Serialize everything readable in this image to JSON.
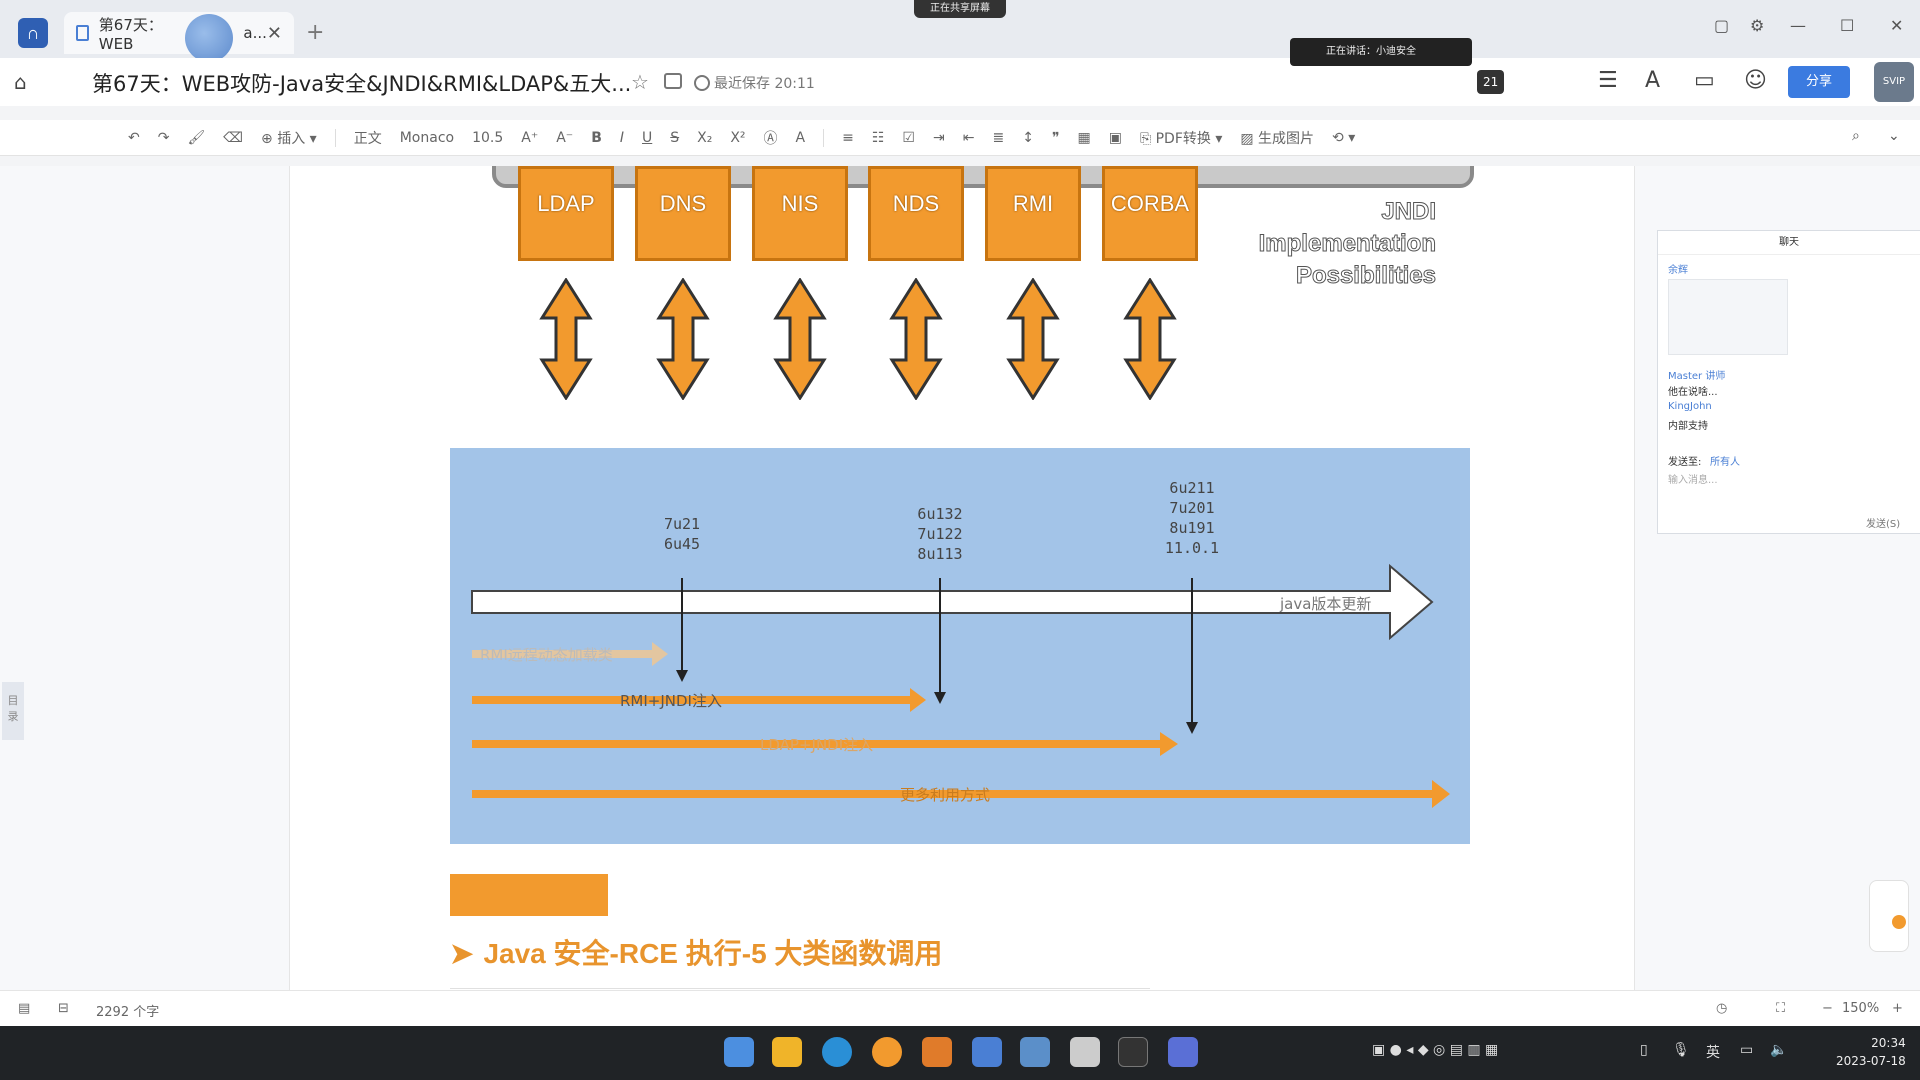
{
  "titlebar": {
    "tab_label": "第67天：WEB",
    "tab_label_tail": "a...",
    "tab_close": "✕",
    "new_tab": "+",
    "share_pill": "正在共享屏幕"
  },
  "docbar": {
    "title": "第67天：WEB攻防-Java安全&JNDI&RMI&LDAP&五大...",
    "saved_status": "最近保存 20:11",
    "speaking": "正在讲话：小迪安全",
    "member_count": "21",
    "share_button": "分享",
    "user_badge": "SVIP"
  },
  "toolbar": {
    "insert": "插入",
    "style": "正文",
    "font": "Monaco",
    "size": "10.5",
    "pdf": "PDF转换",
    "gen_image": "生成图片"
  },
  "figure": {
    "protocols": [
      "LDAP",
      "DNS",
      "NIS",
      "NDS",
      "RMI",
      "CORBA"
    ],
    "caption_line1": "JNDI",
    "caption_line2": "Implementation",
    "caption_line3": "Possibilities",
    "versions": {
      "v1": "7u21\n6u45",
      "v2": "6u132\n7u122\n8u113",
      "v3": "6u211\n7u201\n8u191\n11.0.1"
    },
    "timeline_label": "java版本更新",
    "rows": [
      "RMI远程动态加载类",
      "RMI+JNDI注入",
      "LDAP+JNDI注入",
      "更多利用方式"
    ]
  },
  "heading": "Java 安全-RCE 执行-5 大类函数调用",
  "chat": {
    "title": "聊天",
    "sender1": "余辉",
    "sender2": "Master 讲师",
    "msg2": "他在说啥...",
    "sender3": "KingJohn",
    "msg3": "内部支持",
    "send_to_label": "发送至:",
    "send_to_value": "所有人",
    "input_placeholder": "输入消息...",
    "send_button": "发送(S)"
  },
  "statusbar": {
    "word_count": "2292 个字",
    "zoom": "150%"
  },
  "taskbar": {
    "ime": "英",
    "time": "20:34",
    "date": "2023-07-18"
  },
  "colors": {
    "orange": "#f29a2e",
    "timeline_bg": "#a3c4e8",
    "accent": "#3b7be0"
  }
}
